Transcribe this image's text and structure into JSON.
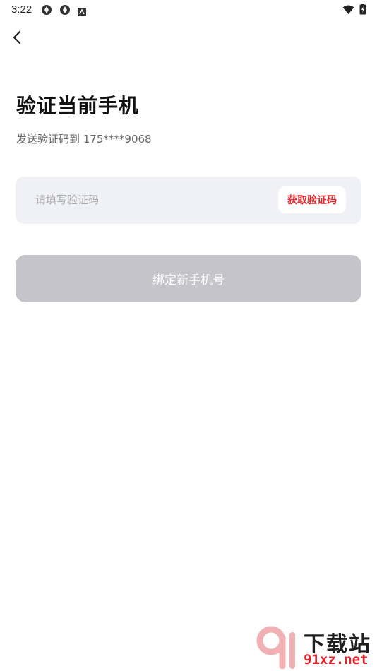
{
  "status_bar": {
    "time": "3:22",
    "icons": [
      "app-icon-1",
      "app-icon-2",
      "notification-icon",
      "wifi-icon",
      "battery-icon"
    ]
  },
  "header": {
    "back_icon": "chevron-left-icon"
  },
  "main": {
    "title": "验证当前手机",
    "subtitle": "发送验证码到 175****9068",
    "code_input": {
      "placeholder": "请填写验证码",
      "value": ""
    },
    "get_code_label": "获取验证码",
    "bind_label": "绑定新手机号"
  },
  "watermark": {
    "text_cn": "下载站",
    "url": "91xz.net"
  },
  "colors": {
    "accent": "#e0242c",
    "input_bg": "#f0f1f6",
    "disabled_button": "#c4c4ca"
  }
}
